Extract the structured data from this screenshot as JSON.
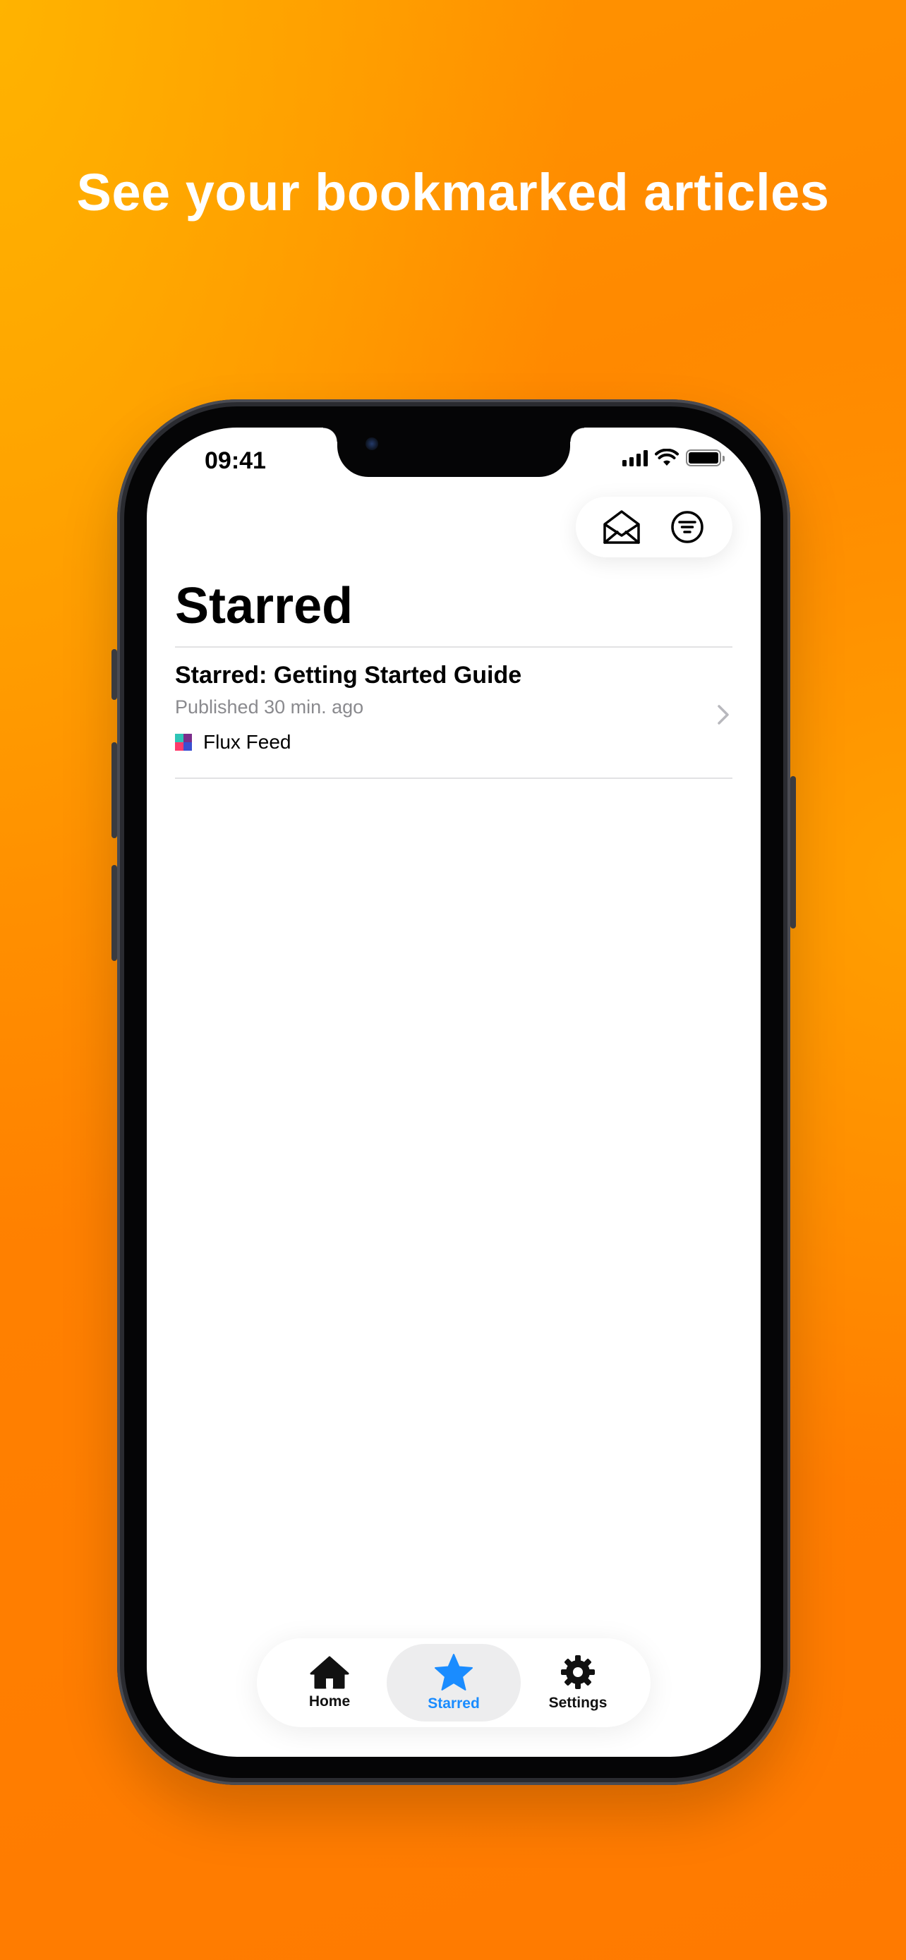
{
  "headline": "See your bookmarked articles",
  "status_bar": {
    "time": "09:41"
  },
  "toolbar": {
    "mail_icon": "envelope-open-icon",
    "filter_icon": "filter-circle-icon"
  },
  "page": {
    "title": "Starred"
  },
  "articles": [
    {
      "title": "Starred: Getting Started Guide",
      "meta": "Published 30 min. ago",
      "feed": "Flux Feed"
    }
  ],
  "tabbar": {
    "tabs": [
      {
        "label": "Home",
        "icon": "house-icon",
        "active": false
      },
      {
        "label": "Starred",
        "icon": "star-icon",
        "active": true
      },
      {
        "label": "Settings",
        "icon": "gear-icon",
        "active": false
      }
    ]
  },
  "colors": {
    "background": "#ff8200",
    "accent": "#1a8cff",
    "text_secondary": "#8a8a8e"
  }
}
